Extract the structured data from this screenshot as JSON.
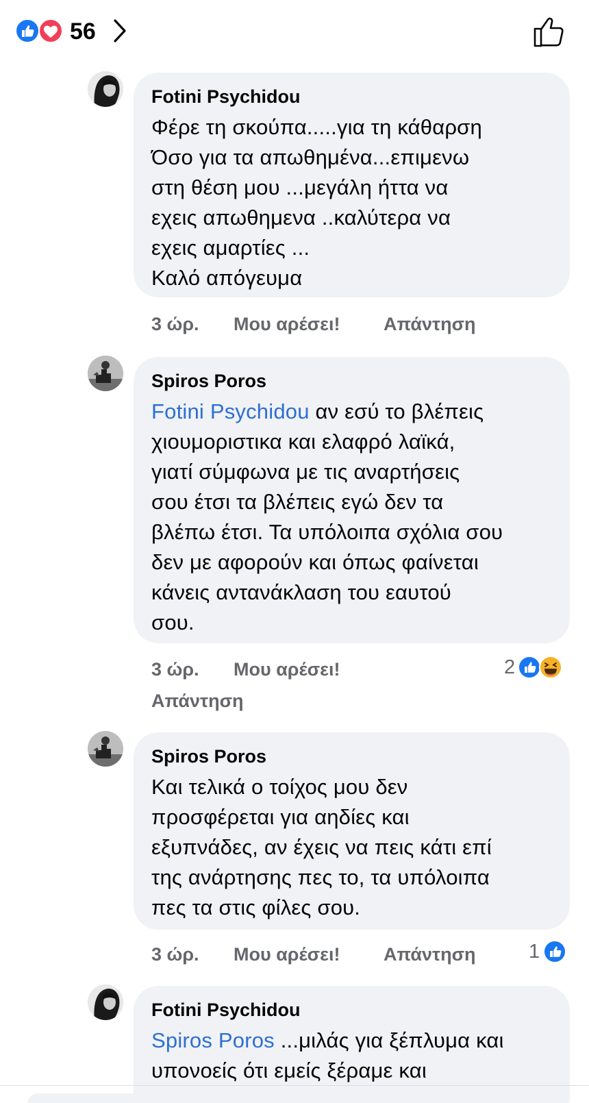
{
  "header": {
    "reaction_count": "56",
    "reaction_icons": [
      "like-icon",
      "love-icon"
    ]
  },
  "colors": {
    "like_blue": "#1877f2",
    "love_red": "#f33e58",
    "mention_blue": "#2d6fd2",
    "bubble_bg": "#f0f2f5",
    "meta_gray": "#65676b"
  },
  "comments": [
    {
      "author": "Fotini Psychidou",
      "mention": "",
      "text": "Φέρε τη σκούπα.....για τη κάθαρση\nΌσο για τα απωθημένα...επιμενω\nστη θέση μου ...μεγάλη ήττα να\nεχεις απωθημενα ..καλύτερα να\nεχεις αμαρτίες ...\nΚαλό απόγευμα",
      "time": "3 ώρ.",
      "like_label": "Μου αρέσει!",
      "reply_label": "Απάντηση",
      "reaction_count": ""
    },
    {
      "author": "Spiros Poros",
      "mention": "Fotini Psychidou",
      "text": " αν εσύ το βλέπεις\nχιουμοριστικα και ελαφρό λαϊκά,\nγιατί σύμφωνα με τις αναρτήσεις\nσου έτσι τα βλέπεις εγώ δεν τα\nβλέπω έτσι. Τα υπόλοιπα σχόλια σου\nδεν με αφορούν και όπως φαίνεται\nκάνεις αντανάκλαση του εαυτού\nσου.",
      "time": "3 ώρ.",
      "like_label": "Μου αρέσει!",
      "reply_label": "Απάντηση",
      "reaction_count": "2"
    },
    {
      "author": "Spiros Poros",
      "mention": "",
      "text": "Και τελικά ο τοίχος μου δεν\nπροσφέρεται για αηδίες και\nεξυπνάδες, αν έχεις να πεις κάτι επί\nτης ανάρτησης πες το, τα υπόλοιπα\nπες τα στις φίλες σου.",
      "time": "3 ώρ.",
      "like_label": "Μου αρέσει!",
      "reply_label": "Απάντηση",
      "reaction_count": "1"
    },
    {
      "author": "Fotini Psychidou",
      "mention": "Spiros Poros",
      "text": " ...μιλάς για ξέπλυμα και\nυπονοείς ότι εμείς ξέραμε και",
      "time": "",
      "like_label": "",
      "reply_label": "",
      "reaction_count": ""
    }
  ]
}
